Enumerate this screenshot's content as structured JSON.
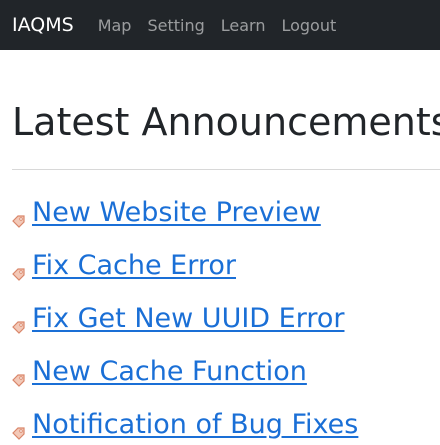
{
  "navbar": {
    "brand": "IAQMS",
    "links": [
      "Map",
      "Setting",
      "Learn",
      "Logout"
    ]
  },
  "main": {
    "title": "Latest Announcements",
    "announcements": [
      "New Website Preview",
      "Fix Cache Error",
      "Fix Get New UUID Error",
      "New Cache Function",
      "Notification of Bug Fixes"
    ],
    "item_icon": "tag-icon"
  },
  "colors": {
    "navbar_bg": "#212529",
    "link": "#1a6fd6",
    "tag_icon": "#e8a38a"
  }
}
